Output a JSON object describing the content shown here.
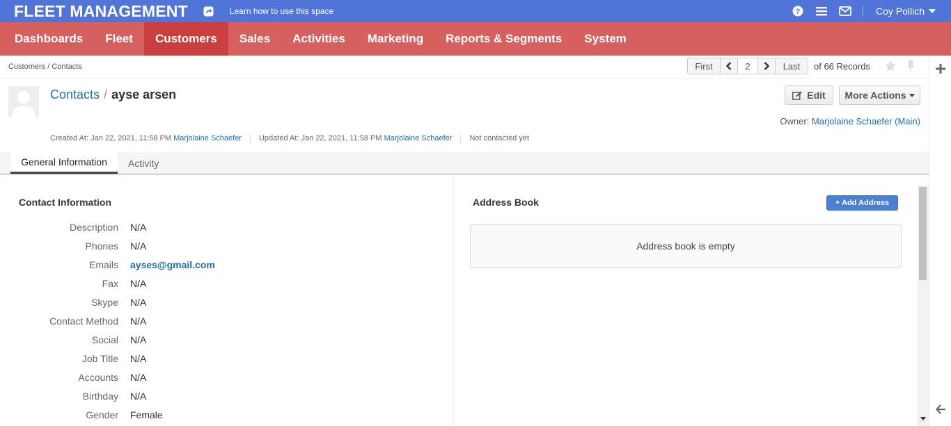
{
  "topbar": {
    "app_title": "FLEET MANAGEMENT",
    "learn_link": "Learn how to use this space",
    "user_name": "Coy Pollich",
    "icons": [
      "share-icon",
      "help-icon",
      "menu-icon",
      "mail-icon"
    ]
  },
  "nav": {
    "items": [
      "Dashboards",
      "Fleet",
      "Customers",
      "Sales",
      "Activities",
      "Marketing",
      "Reports & Segments",
      "System"
    ],
    "active": "Customers"
  },
  "breadcrumb": "Customers / Contacts",
  "pager": {
    "first": "First",
    "page": "2",
    "last": "Last",
    "records": "of 66 Records"
  },
  "header": {
    "entity_link": "Contacts",
    "separator": "/",
    "record_name": "ayse arsen",
    "edit_label": "Edit",
    "more_actions_label": "More Actions",
    "owner_label": "Owner:",
    "owner_name": "Marjolaine Schaefer (Main)"
  },
  "meta": {
    "created_label": "Created At: Jan 22, 2021, 11:58 PM",
    "created_by": "Marjolaine Schaefer",
    "updated_label": "Updated At: Jan 22, 2021, 11:58 PM",
    "updated_by": "Marjolaine Schaefer",
    "contacted": "Not contacted yet"
  },
  "tabs": [
    "General Information",
    "Activity"
  ],
  "contact_info": {
    "title": "Contact Information",
    "fields": [
      {
        "label": "Description",
        "value": "N/A"
      },
      {
        "label": "Phones",
        "value": "N/A"
      },
      {
        "label": "Emails",
        "value": "ayses@gmail.com"
      },
      {
        "label": "Fax",
        "value": "N/A"
      },
      {
        "label": "Skype",
        "value": "N/A"
      },
      {
        "label": "Contact Method",
        "value": "N/A"
      },
      {
        "label": "Social",
        "value": "N/A"
      },
      {
        "label": "Job Title",
        "value": "N/A"
      },
      {
        "label": "Accounts",
        "value": "N/A"
      },
      {
        "label": "Birthday",
        "value": "N/A"
      },
      {
        "label": "Gender",
        "value": "Female"
      }
    ]
  },
  "address_book": {
    "title": "Address Book",
    "add_label": "+ Add Address",
    "empty_text": "Address book is empty"
  },
  "colors": {
    "topbar": "#5174d9",
    "nav": "#d65f5f",
    "nav_active": "#cb3e3e",
    "link": "#1f6fa8"
  }
}
